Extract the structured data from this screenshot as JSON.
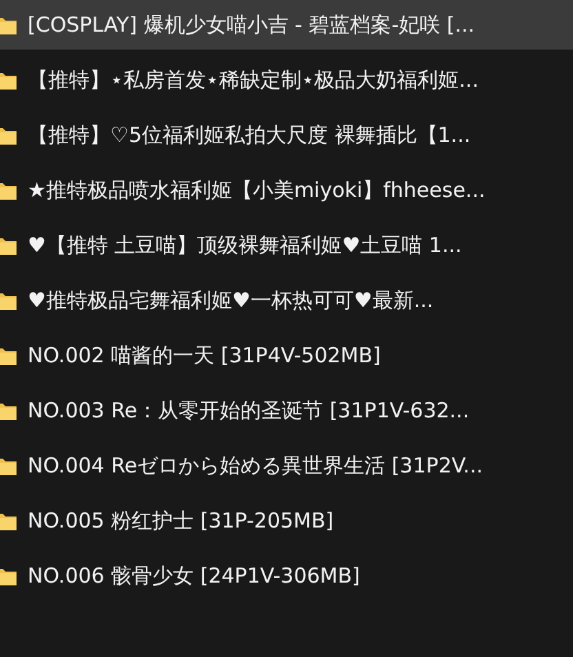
{
  "folders": [
    {
      "name": "[COSPLAY] 爆机少女喵小吉 - 碧蓝档案-妃咲 [...",
      "selected": true
    },
    {
      "name": "【推特】⋆私房首发⋆稀缺定制⋆极品大奶福利姬...",
      "selected": false
    },
    {
      "name": "【推特】♡5位福利姬私拍大尺度 裸舞插比【1...",
      "selected": false
    },
    {
      "name": "★推特极品喷水福利姬【小美miyoki】fhheese...",
      "selected": false
    },
    {
      "name": "♥【推特 土豆喵】顶级裸舞福利姬♥土豆喵 1...",
      "selected": false
    },
    {
      "name": "♥推特极品宅舞福利姬♥一杯热可可♥最新...",
      "selected": false
    },
    {
      "name": "NO.002 喵酱的一天 [31P4V-502MB]",
      "selected": false
    },
    {
      "name": "NO.003 Re：从零开始的圣诞节 [31P1V-632...",
      "selected": false
    },
    {
      "name": "NO.004 Reゼロから始める異世界生活 [31P2V...",
      "selected": false
    },
    {
      "name": "NO.005 粉红护士 [31P-205MB]",
      "selected": false
    },
    {
      "name": "NO.006 骸骨少女 [24P1V-306MB]",
      "selected": false
    }
  ]
}
